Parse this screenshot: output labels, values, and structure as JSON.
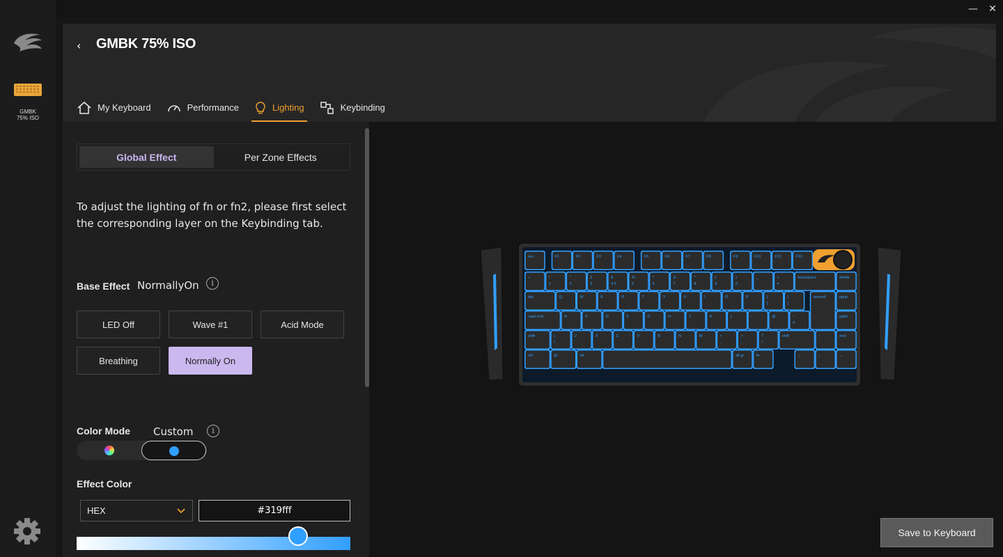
{
  "window": {
    "minimize_glyph": "—",
    "close_glyph": "✕"
  },
  "sidebar": {
    "logo_icon": "gmbk-logo-icon",
    "device": {
      "label": "GMBK\n75% ISO",
      "accent": "#e8a53a"
    },
    "settings_icon": "gear-icon"
  },
  "header": {
    "back_glyph": "‹",
    "title": "GMBK 75% ISO",
    "tabs": [
      {
        "label": "My Keyboard",
        "icon": "home-icon",
        "active": false
      },
      {
        "label": "Performance",
        "icon": "gauge-icon",
        "active": false
      },
      {
        "label": "Lighting",
        "icon": "bulb-icon",
        "active": true
      },
      {
        "label": "Keybinding",
        "icon": "keybinding-icon",
        "active": false
      }
    ]
  },
  "lighting": {
    "segments": {
      "global": "Global Effect",
      "per_zone": "Per Zone Effects"
    },
    "info": "To adjust the lighting of fn or fn2, please first select the corresponding layer on the Keybinding tab.",
    "base_effect": {
      "label": "Base Effect",
      "value": "NormallyOn",
      "options": [
        "LED Off",
        "Wave #1",
        "Acid Mode",
        "Breathing",
        "Normally On"
      ],
      "selected": "Normally On"
    },
    "color_mode": {
      "label": "Color Mode",
      "value": "Custom",
      "info_glyph": "i"
    },
    "effect_color": {
      "label": "Effect Color",
      "format": "HEX",
      "hex": "#319fff",
      "slider_level": 0.81
    }
  },
  "preview": {
    "led_color": "#319fff",
    "knob_accent": "#f0a030"
  },
  "footer": {
    "save_label": "Save to Keyboard"
  },
  "colors": {
    "accent": "#f0a030",
    "selected_effect": "#cbb8ee",
    "panel": "#1f1f1f",
    "header": "#262626"
  },
  "keyboard_legends": {
    "row0": [
      "esc",
      "F1",
      "F2",
      "F3",
      "F4",
      "F5",
      "F6",
      "F7",
      "F8",
      "F9",
      "F10",
      "F11",
      "F12"
    ],
    "row1": [
      "¬\n`",
      "!\n1",
      "\"\n2",
      "£\n3",
      "$\n4 €",
      "%\n5",
      "^\n6",
      "&\n7",
      "*\n8",
      "(\n9",
      ")\n0",
      "_\n-",
      "+\n=",
      "backspace",
      "delete"
    ],
    "row2": [
      "tab",
      "Q",
      "W",
      "E",
      "R",
      "T",
      "Y",
      "U",
      "I",
      "O",
      "P",
      "{\n[",
      "}\n]",
      "ascend",
      "pgup"
    ],
    "row3": [
      "caps lock",
      "A",
      "S",
      "D",
      "F",
      "G",
      "H",
      "J",
      "K",
      "L",
      ":\n;",
      "@\n'",
      "~\n#",
      "pgdn"
    ],
    "row4": [
      "shift",
      "|\n\\",
      "Z",
      "X",
      "C",
      "V",
      "B",
      "N",
      "M",
      "<\n,",
      ">\n.",
      "?\n/",
      "shift",
      "↑",
      "end"
    ],
    "row5": [
      "ctrl",
      "⊞",
      "alt",
      "",
      "alt gr",
      "fn",
      "←",
      "↓",
      "→"
    ]
  }
}
